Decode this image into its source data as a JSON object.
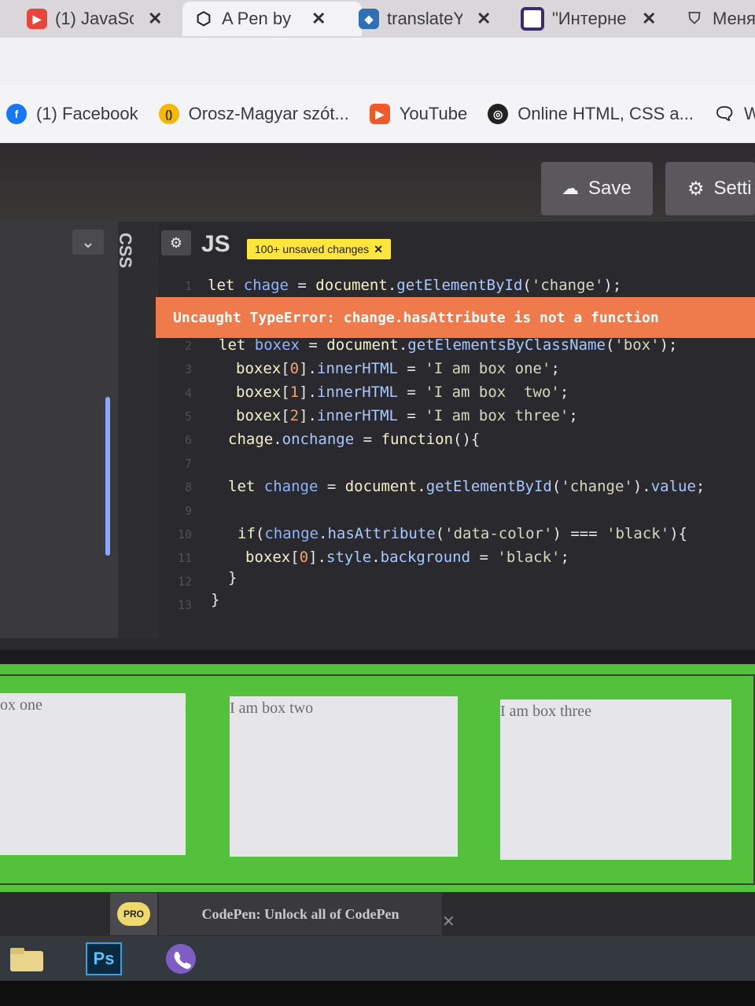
{
  "browser": {
    "tabs": [
      {
        "label": "(1) JavaSc",
        "icon": "youtube-icon"
      },
      {
        "label": "A Pen by",
        "icon": "codepen-icon",
        "active": true
      },
      {
        "label": "translateY",
        "icon": "stackoverflow-icon"
      },
      {
        "label": "\"Интерне",
        "icon": "square-icon"
      },
      {
        "label": "Меня",
        "icon": "shield-icon"
      }
    ],
    "close_glyph": "✕"
  },
  "bookmarks": [
    {
      "label": "(1) Facebook",
      "icon": "facebook-icon"
    },
    {
      "label": "Orosz-Magyar szót...",
      "icon": "dictionary-icon"
    },
    {
      "label": "YouTube",
      "icon": "youtube-icon"
    },
    {
      "label": "Online HTML, CSS a...",
      "icon": "online-editor-icon"
    },
    {
      "label": "We",
      "icon": "chat-icon"
    }
  ],
  "header": {
    "save_label": "Save",
    "settings_label": "Setti"
  },
  "editor": {
    "css_label": "CSS",
    "js_label": "JS",
    "unsaved_badge": "100+ unsaved changes",
    "error_message": "Uncaught TypeError: change.hasAttribute is not a function",
    "line_numbers": [
      "1",
      "2",
      "3",
      "4",
      "5",
      "6",
      "7",
      "8",
      "9",
      "10",
      "11",
      "12",
      "13"
    ]
  },
  "preview": {
    "boxes": [
      "ox one",
      "I am box two",
      "I am box three"
    ]
  },
  "promo": {
    "badge": "PRO",
    "text": "CodePen: Unlock all of CodePen",
    "close": "✕"
  },
  "taskbar": {
    "apps": [
      "file-explorer-icon",
      "photoshop-icon",
      "viber-icon"
    ],
    "photoshop_label": "Ps"
  }
}
